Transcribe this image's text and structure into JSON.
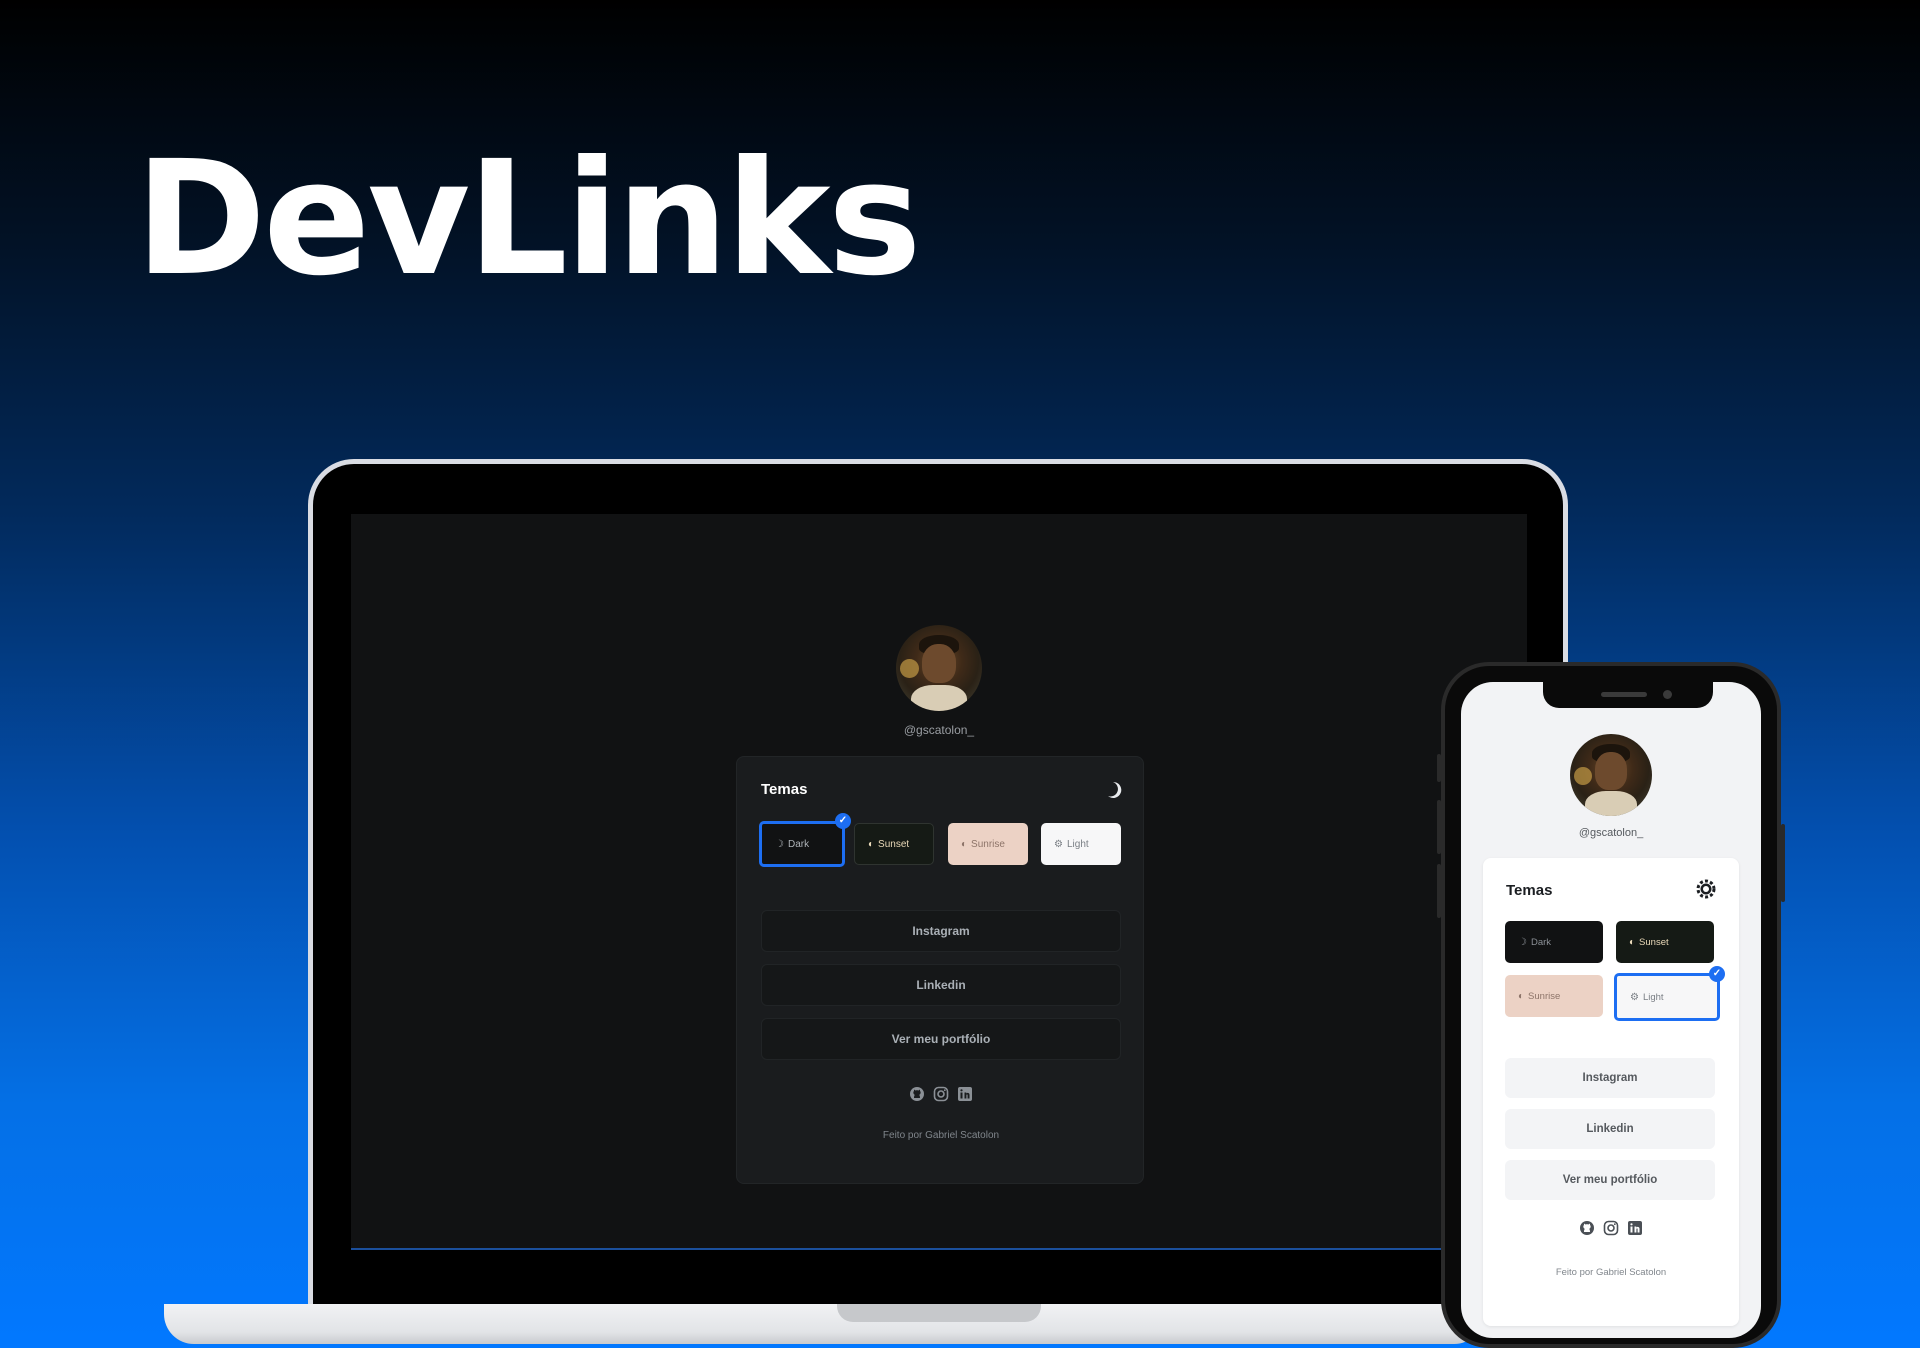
{
  "hero": {
    "title": "DevLinks"
  },
  "profile": {
    "username": "@gscatolon_",
    "card_title": "Temas",
    "themes": [
      {
        "label": "Dark",
        "icon": "moon-icon"
      },
      {
        "label": "Sunset",
        "icon": "contrast-icon"
      },
      {
        "label": "Sunrise",
        "icon": "contrast-icon"
      },
      {
        "label": "Light",
        "icon": "sun-icon"
      }
    ],
    "links": [
      "Instagram",
      "Linkedin",
      "Ver meu portfólio"
    ],
    "socials": [
      "github-icon",
      "instagram-icon",
      "linkedin-icon"
    ],
    "footer": "Feito por Gabriel Scatolon"
  },
  "laptop": {
    "selected_theme": "Dark",
    "toggle_icon": "moon-icon"
  },
  "phone": {
    "selected_theme": "Light",
    "toggle_icon": "sun-icon"
  },
  "colors": {
    "accent": "#1d6ef2",
    "dark_bg": "#111213",
    "sunset_bg": "#151a15",
    "sunrise_bg": "#ecd2c5",
    "light_bg": "#f7f7f8"
  }
}
